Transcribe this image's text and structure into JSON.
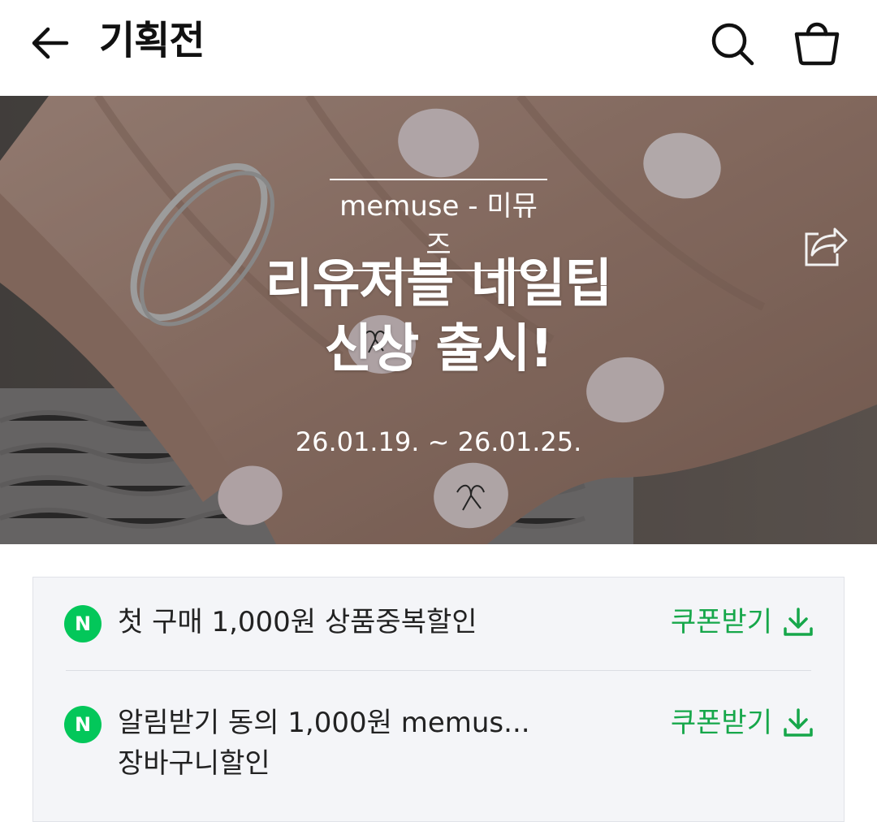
{
  "header": {
    "title": "기획전",
    "icons": [
      "back-arrow-icon",
      "search-icon",
      "shopping-bag-icon"
    ]
  },
  "hero": {
    "brand": "memuse - 미뮤즈",
    "title_line1": "리유저블 네일팁",
    "title_line2": "신상 출시!",
    "date_range": "26.01.19. ~ 26.01.25.",
    "share_icon": "share-icon"
  },
  "coupons": {
    "items": [
      {
        "badge": "N",
        "text_line1": "첫 구매 1,000원 상품중복할인",
        "text_line2": "",
        "action": "쿠폰받기"
      },
      {
        "badge": "N",
        "text_line1": "알림받기 동의 1,000원 memus...",
        "text_line2": "장바구니할인",
        "action": "쿠폰받기"
      }
    ]
  },
  "colors": {
    "naver_green": "#03c75a",
    "action_green": "#16a74a",
    "coupon_bg": "#f4f5f8"
  }
}
